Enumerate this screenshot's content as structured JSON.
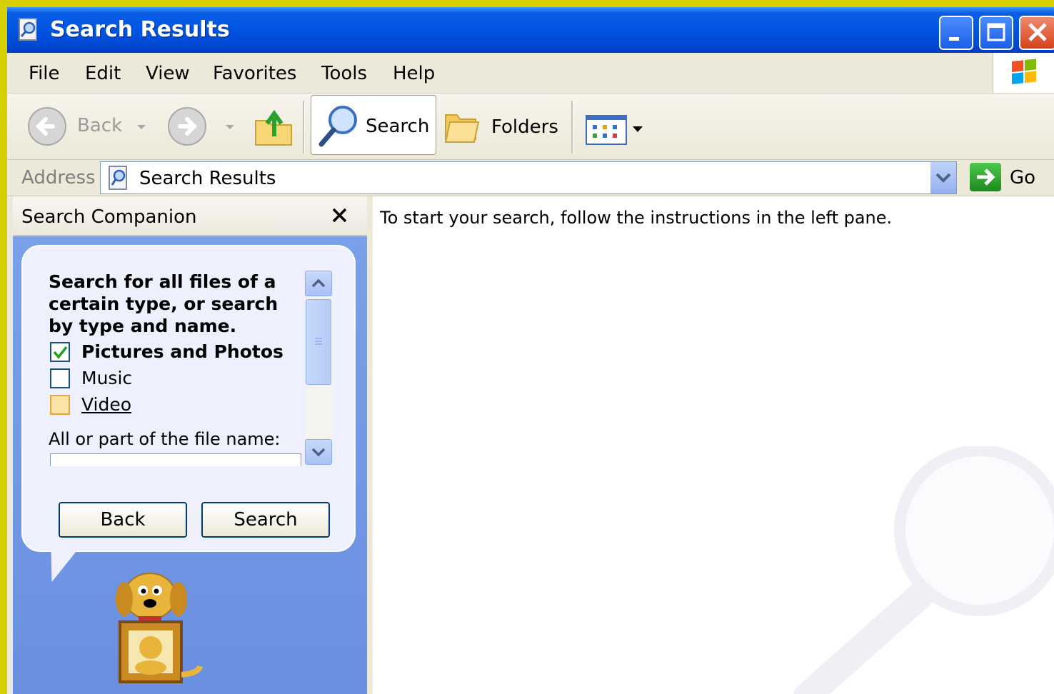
{
  "window": {
    "title": "Search Results",
    "controls": [
      "minimize",
      "maximize",
      "close"
    ]
  },
  "menu": [
    "File",
    "Edit",
    "View",
    "Favorites",
    "Tools",
    "Help"
  ],
  "toolbar": {
    "back_label": "Back",
    "search_label": "Search",
    "folders_label": "Folders"
  },
  "address": {
    "label": "Address",
    "value": "Search Results",
    "go_label": "Go"
  },
  "search_pane": {
    "title": "Search Companion",
    "prompt": "Search for all files of a certain type, or search by type and name.",
    "options": [
      {
        "label": "Pictures and Photos",
        "checked": true
      },
      {
        "label": "Music",
        "checked": false
      },
      {
        "label": "Video",
        "checked": false
      }
    ],
    "filename_label": "All or part of the file name:",
    "filename_value": "",
    "back_button": "Back",
    "search_button": "Search"
  },
  "results_pane": {
    "message": "To start your search, follow the instructions in the left pane."
  },
  "colors": {
    "titlebar": "#0054e3",
    "pane_background": "#7ba0e8",
    "checkbox_check": "#21a121"
  }
}
